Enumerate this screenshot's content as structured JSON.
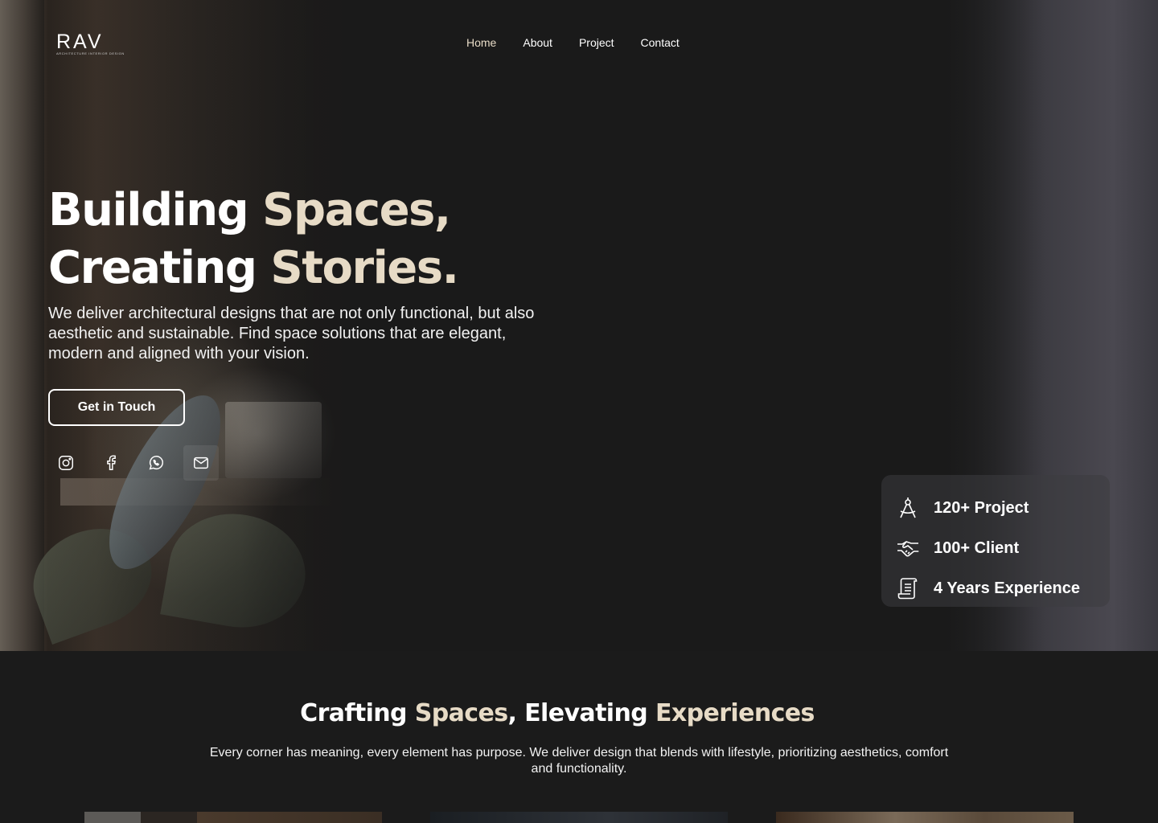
{
  "brand": {
    "logo_text": "RAV",
    "logo_subtitle": "ARCHITECTURE INTERIOR DESIGN"
  },
  "nav": {
    "items": [
      {
        "label": "Home",
        "active": true
      },
      {
        "label": "About",
        "active": false
      },
      {
        "label": "Project",
        "active": false
      },
      {
        "label": "Contact",
        "active": false
      }
    ]
  },
  "hero": {
    "headline_line1_a": "Building ",
    "headline_line1_b": "Spaces,",
    "headline_line2_a": "Creating ",
    "headline_line2_b": "Stories.",
    "subtext": "We deliver architectural designs that are not only functional, but also aesthetic and sustainable. Find space solutions that are elegant, modern and aligned with your vision.",
    "cta_label": "Get in Touch",
    "socials": [
      "instagram-icon",
      "facebook-icon",
      "whatsapp-icon",
      "mail-icon"
    ]
  },
  "stats": [
    {
      "icon": "compass-icon",
      "label": "120+ Project"
    },
    {
      "icon": "handshake-icon",
      "label": "100+ Client"
    },
    {
      "icon": "scroll-icon",
      "label": "4 Years Experience"
    }
  ],
  "section2": {
    "title_a": "Crafting ",
    "title_b": "Spaces",
    "title_c": ", Elevating ",
    "title_d": "Experiences",
    "text": "Every corner has meaning, every element has purpose. We deliver design that blends with lifestyle, prioritizing aesthetics, comfort and functionality."
  },
  "colors": {
    "accent": "#e7dbc6",
    "background": "#1b1b1b",
    "text": "#ffffff"
  }
}
